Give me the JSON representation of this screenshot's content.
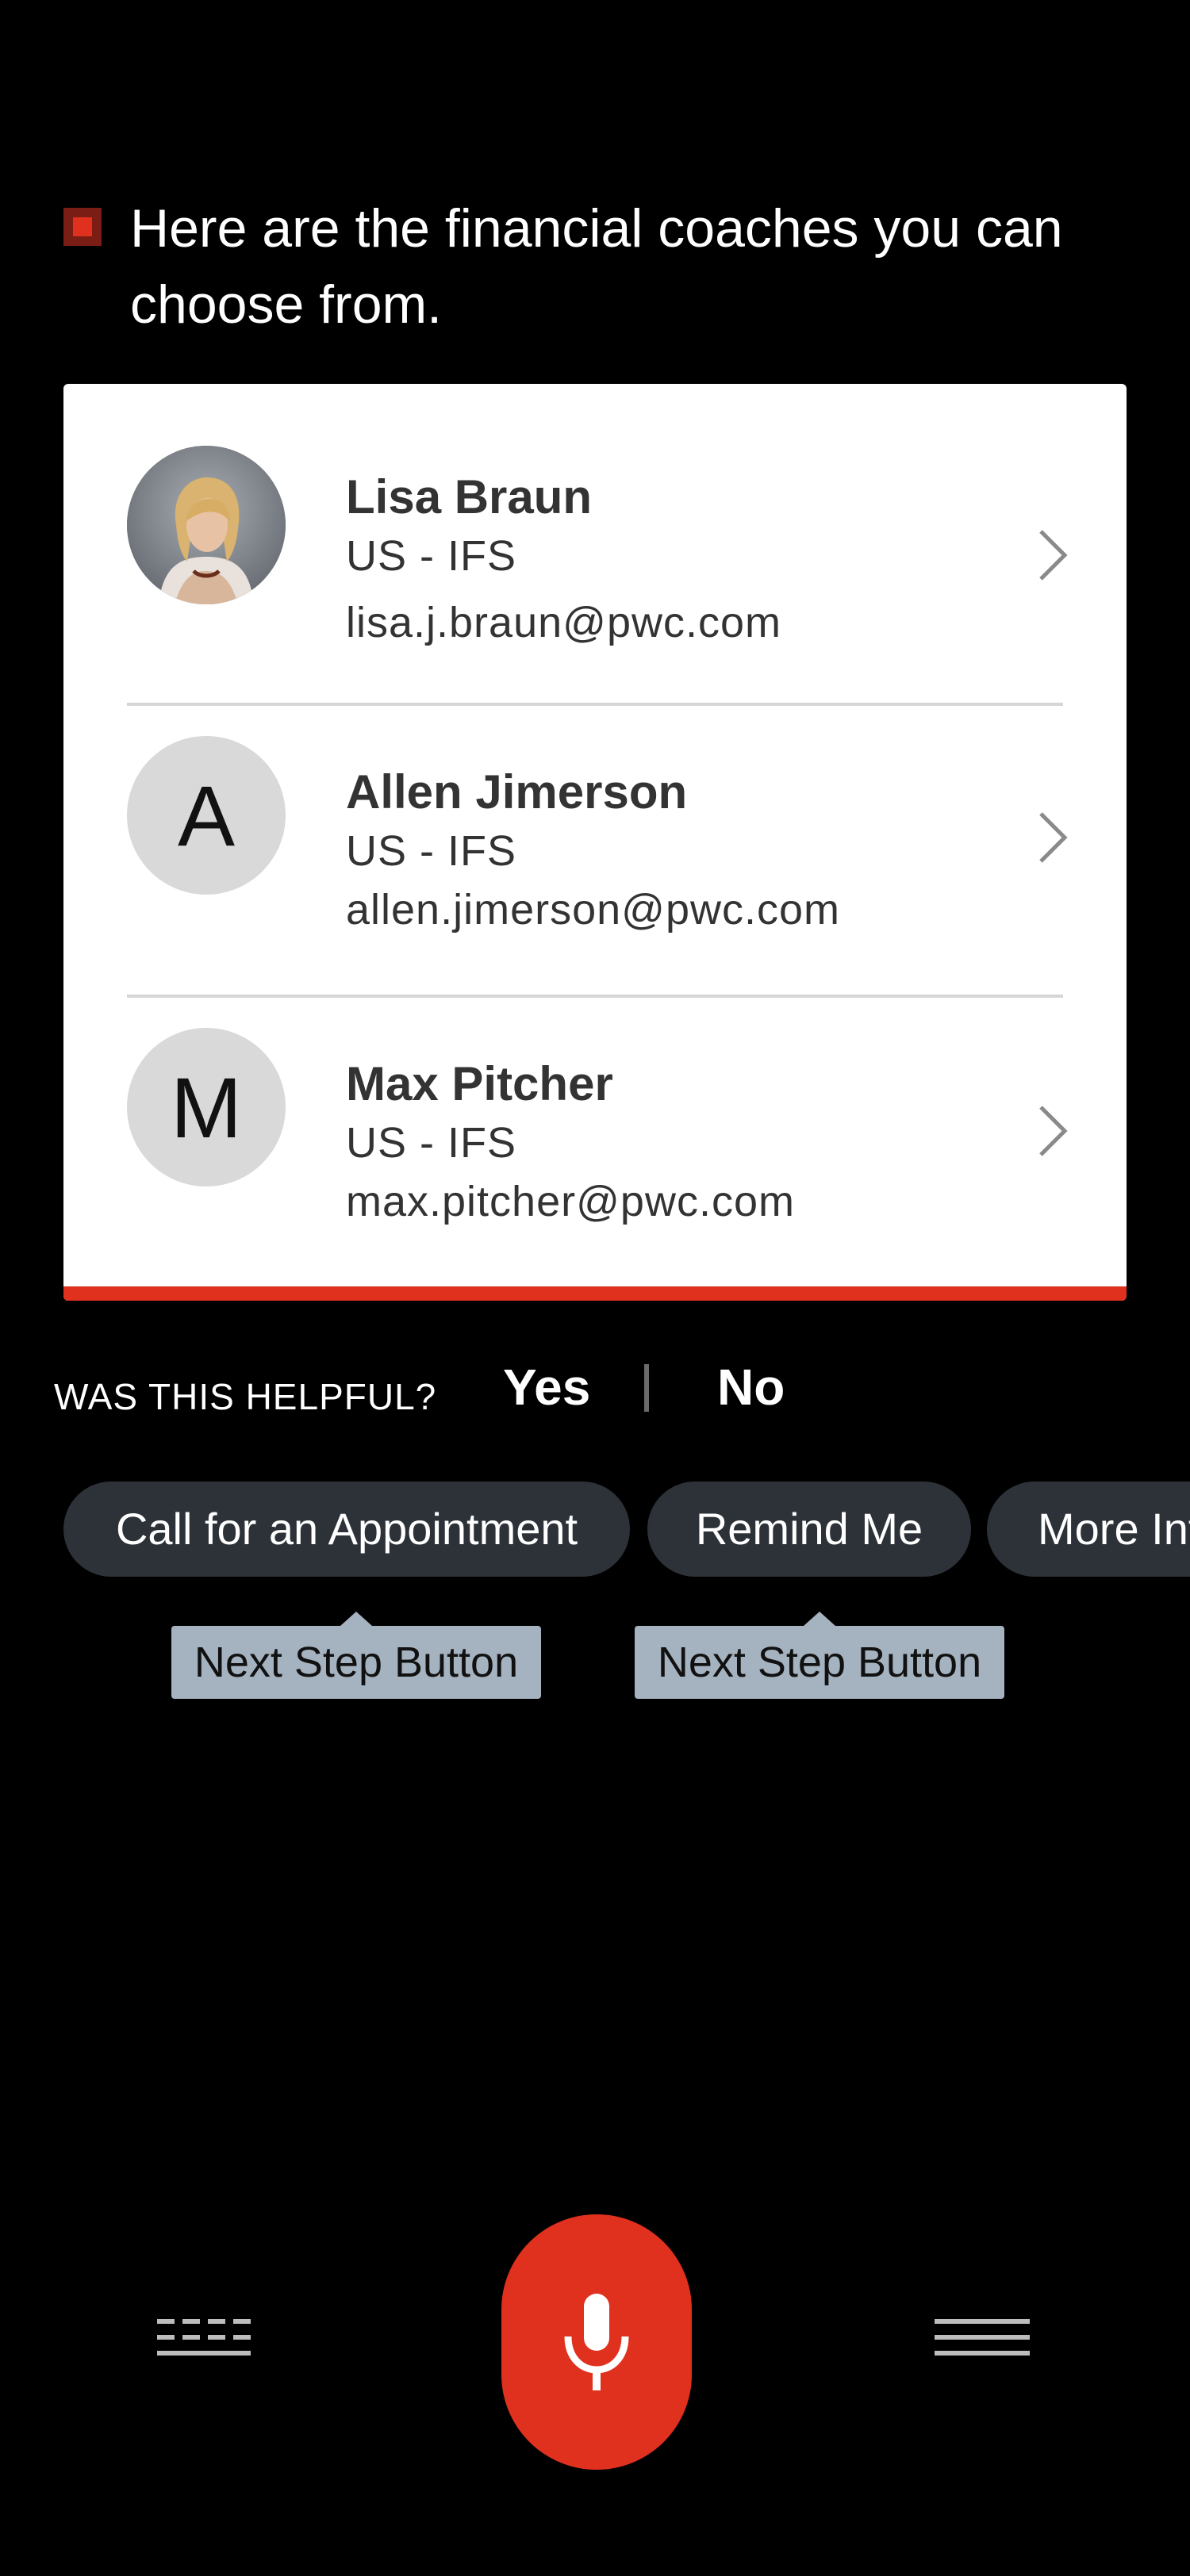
{
  "message": {
    "text": "Here are the financial coaches you can choose from."
  },
  "coaches": [
    {
      "name": "Lisa Braun",
      "org": "US - IFS",
      "email": "lisa.j.braun@pwc.com",
      "avatar_type": "photo",
      "initial": ""
    },
    {
      "name": "Allen Jimerson",
      "org": "US - IFS",
      "email": "allen.jimerson@pwc.com",
      "avatar_type": "initial",
      "initial": "A"
    },
    {
      "name": "Max Pitcher",
      "org": "US - IFS",
      "email": "max.pitcher@pwc.com",
      "avatar_type": "initial",
      "initial": "M"
    }
  ],
  "feedback": {
    "question": "WAS THIS HELPFUL?",
    "yes": "Yes",
    "no": "No"
  },
  "chips": [
    {
      "label": "Call for an Appointment"
    },
    {
      "label": "Remind Me"
    },
    {
      "label": "More Info"
    }
  ],
  "tooltips": [
    {
      "label": "Next Step Button"
    },
    {
      "label": "Next Step Button"
    }
  ],
  "bottom_bar": {
    "left_icon": "keyboard-icon",
    "center_icon": "microphone-icon",
    "right_icon": "menu-icon"
  },
  "colors": {
    "accent": "#e0301e",
    "chip_bg": "#2d3238",
    "tooltip_bg": "#a5b2bf",
    "card_bg": "#ffffff",
    "background": "#000000"
  }
}
